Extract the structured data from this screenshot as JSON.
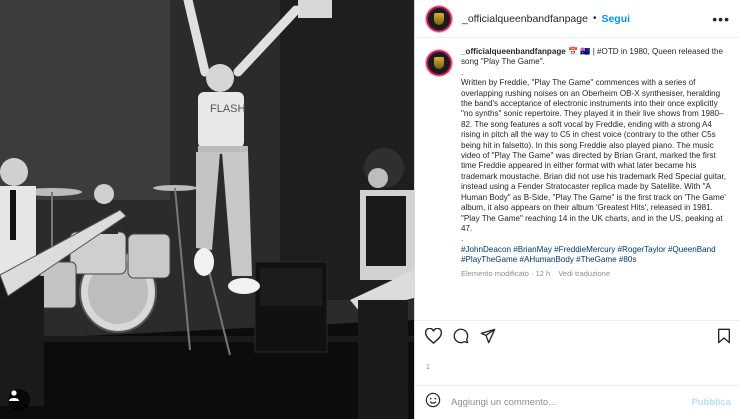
{
  "post": {
    "username": "_officialqueenbandfanpage",
    "dot": "•",
    "follow_label": "Segui",
    "more_icon": "more-horizontal-icon"
  },
  "caption": {
    "username": "_officialqueenbandfanpage",
    "emoji": "📅 🇦🇺",
    "intro": "| #OTD in 1980, Queen released the song \"Play The Game\".",
    "dot_line": ".",
    "body": "Written by Freddie, \"Play The Game\" commences with a series of overlapping rushing noises on an Oberheim OB-X synthesiser, heralding the band's acceptance of electronic instruments into their once explicitly \"no synths\" sonic repertoire. They played it in their live shows from 1980–82. The song features a soft vocal by Freddie, ending with a strong A4 rising in pitch all the way to C5 in chest voice (contrary to the other C5s being hit in falsetto). In this song Freddie also played piano. The music video of \"Play The Game\" was directed by Brian Grant, marked the first time Freddie appeared in either format with what later became his trademark moustache. Brian did not use his trademark Red Special guitar, instead using a Fender Stratocaster replica made by Satellite. With \"A Human Body\" as B-Side, \"Play The Game\" is the first track on 'The Game' album, it also appears on their album 'Greatest Hits', released in 1981. \"Play The Game\" reaching 14 in the UK charts, and in the US, peaking at 47.",
    "dot_line_2": ".",
    "hashtags": "#JohnDeacon #BrianMay #FreddieMercury #RogerTaylor #QueenBand #PlayTheGame #AHumanBody #TheGame #80s",
    "edited": "Elemento modificato · 12 h",
    "translate": "Vedi traduzione"
  },
  "actions": {
    "like_icon": "heart-icon",
    "comment_icon": "comment-icon",
    "share_icon": "share-icon",
    "save_icon": "bookmark-icon"
  },
  "date_label": "1",
  "comment": {
    "emoji_icon": "smiley-icon",
    "placeholder": "Aggiungi un commento...",
    "publish_label": "Pubblica"
  }
}
